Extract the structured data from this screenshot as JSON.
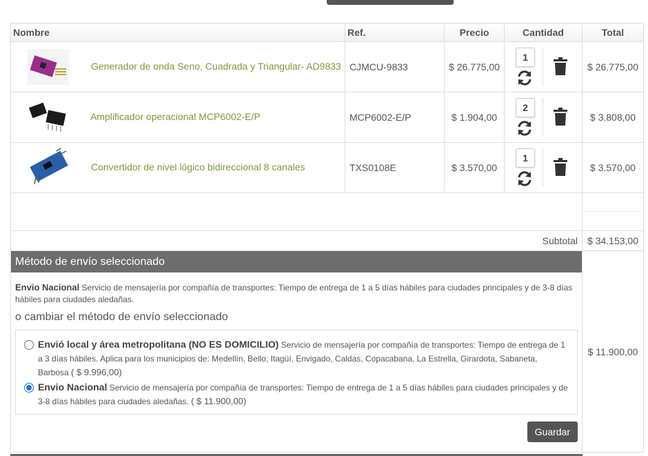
{
  "table": {
    "headers": {
      "name": "Nombre",
      "ref": "Ref.",
      "price": "Precio",
      "qty": "Cantidad",
      "total": "Total"
    }
  },
  "items": [
    {
      "name": "Generador de onda Seno, Cuadrada y Triangular- AD9833",
      "ref": "CJMCU-9833",
      "price": "$ 26.775,00",
      "qty": "1",
      "total": "$ 26.775,00",
      "image": "purple-breakout-board-image"
    },
    {
      "name": "Amplificador operacional MCP6002-E/P",
      "ref": "MCP6002-E/P",
      "price": "$ 1.904,00",
      "qty": "2",
      "total": "$ 3.808,00",
      "image": "dip8-chip-image"
    },
    {
      "name": "Convertidor de nivel lógico bidireccional 8 canales",
      "ref": "TXS0108E",
      "price": "$ 3.570,00",
      "qty": "1",
      "total": "$ 3.570,00",
      "image": "blue-breakout-board-image"
    }
  ],
  "subtotal": {
    "label": "Subtotal",
    "value": "$ 34.153,00"
  },
  "shipping": {
    "header": "Método de envío seleccionado",
    "current_name": "Envio Nacional",
    "current_desc": "Servicio de mensajería por compañía de transportes: Tiempo de entrega de 1 a 5 días hábiles para ciudades principales y de 3-8 días hábiles para ciudades aledañas.",
    "change_label": "o cambiar el método de envío seleccionado",
    "options": [
      {
        "name": "Envió local y área metropolitana (NO ES DOMICILIO)",
        "desc": "Servicio de mensajería por compañía de transportes: Tiempo de entrega de 1 a 3 días hábiles. Aplica para los municipios de: Medellín, Bello, Itagüí, Envigado, Caldas, Copacabana, La Estrella, Girardota, Sabaneta, Barbosa",
        "price": "( $ 9.996,00)",
        "selected": false
      },
      {
        "name": "Envio Nacional",
        "desc": "Servicio de mensajería por compañía de transportes: Tiempo de entrega de 1 a 5 días hábiles para ciudades principales y de 3-8 días hábiles para ciudades aledañas.",
        "price": "( $ 11.900,00)",
        "selected": true
      }
    ],
    "save_label": "Guardar",
    "total": "$ 11.900,00"
  },
  "colors": {
    "link": "#7e9a3c",
    "header_bar": "#6d6d6d",
    "radio_selected": "#1a73e8",
    "button": "#555555"
  },
  "icons": {
    "refresh": "refresh-icon",
    "delete": "trash-icon"
  }
}
